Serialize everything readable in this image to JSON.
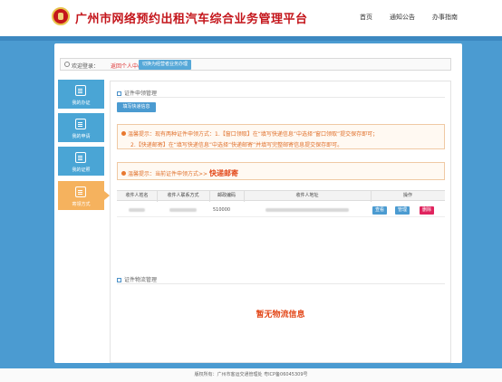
{
  "header": {
    "title": "广州市网络预约出租汽车综合业务管理平台",
    "nav": [
      "首页",
      "通知公告",
      "办事指南"
    ]
  },
  "welcome": {
    "label": "欢迎登录：",
    "center_link": "返回个人中心",
    "switch_button": "切换为经营者业务办理"
  },
  "sidebar": {
    "items": [
      {
        "label": "我的办证",
        "icon": "id-card-icon"
      },
      {
        "label": "我的申请",
        "icon": "document-icon"
      },
      {
        "label": "我的证照",
        "icon": "license-icon"
      },
      {
        "label": "寄领方式",
        "icon": "mail-icon"
      }
    ]
  },
  "main": {
    "section1_title": "证件申领管理",
    "fill_button": "填写快递信息",
    "notice1_line1": "温馨提示：现有两种证件申领方式：1.【窗口领取】在“填写快递信息”中选择“窗口领取”提交保存即可；",
    "notice1_line2": "2.【快递邮寄】在“填写快递信息”中选择“快递邮寄”并填写完整邮寄信息提交保存即可。",
    "notice2_prefix": "温馨提示：当前证件申领方式>>",
    "notice2_value": "快递邮寄",
    "table": {
      "headers": [
        "收件人姓名",
        "收件人联系方式",
        "邮政编码",
        "收件人地址",
        "操作"
      ],
      "row": {
        "postal_code": "510000"
      },
      "actions": [
        "查看",
        "管理",
        "删除"
      ]
    },
    "section2_title": "证件物流管理",
    "empty_text": "暂无物流信息"
  },
  "footer": {
    "text": "版权所有：广州市客运交通管理处  粤ICP备06045309号"
  },
  "colors": {
    "brand_red": "#c4161c",
    "band_blue": "#4b9bd1",
    "active_orange": "#f5b25e",
    "delete_red": "#e0245e"
  }
}
